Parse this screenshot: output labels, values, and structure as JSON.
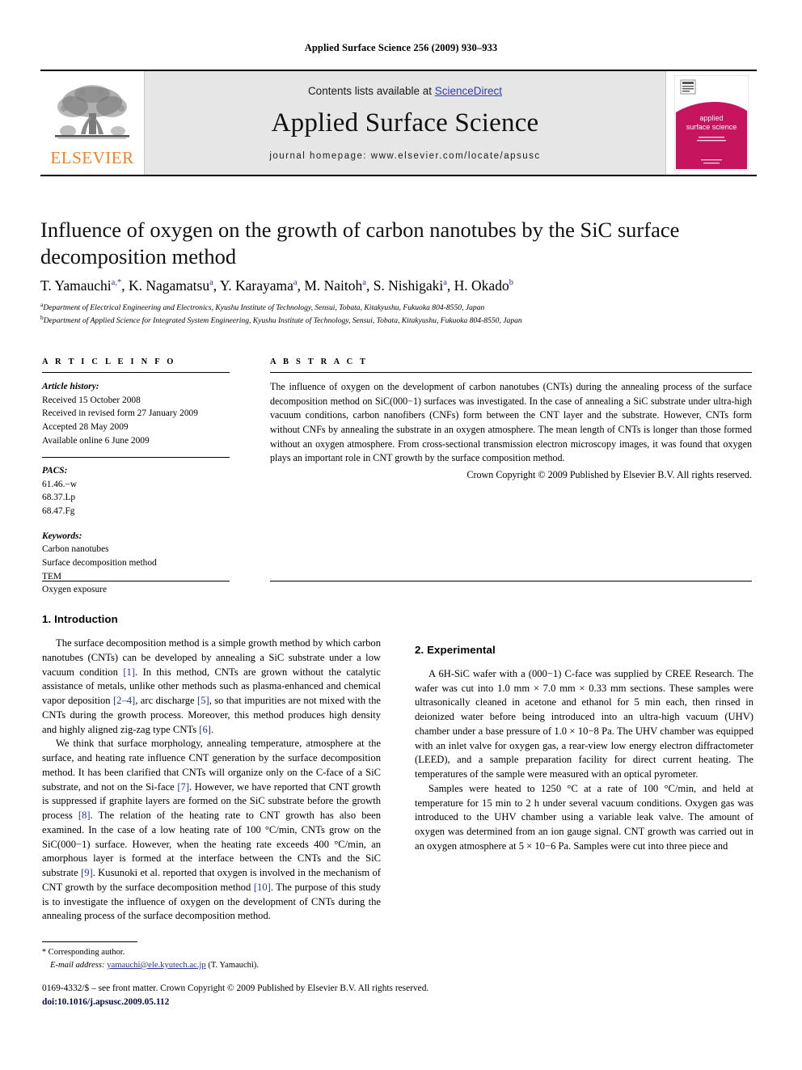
{
  "running_head": "Applied Surface Science 256 (2009) 930–933",
  "masthead": {
    "publisher_name": "ELSEVIER",
    "publisher_logo_icon": "elsevier-tree-icon",
    "contents_prefix": "Contents lists available at ",
    "contents_link": "ScienceDirect",
    "journal_title": "Applied Surface Science",
    "homepage": "journal homepage: www.elsevier.com/locate/apsusc",
    "cover_title_line1": "applied",
    "cover_title_line2": "surface science",
    "cover_color": "#C6145F"
  },
  "article": {
    "title": "Influence of oxygen on the growth of carbon nanotubes by the SiC surface decomposition method",
    "authors": "T. Yamauchi a,*, K. Nagamatsu a, Y. Karayama a, M. Naitoh a, S. Nishigaki a, H. Okado b",
    "affiliation_a": "Department of Electrical Engineering and Electronics, Kyushu Institute of Technology, Sensui, Tobata, Kitakyushu, Fukuoka 804-8550, Japan",
    "affiliation_b": "Department of Applied Science for Integrated System Engineering, Kyushu Institute of Technology, Sensui, Tobata, Kitakyushu, Fukuoka 804-8550, Japan"
  },
  "info": {
    "heading": "A R T I C L E   I N F O",
    "history_label": "Article history:",
    "history": [
      "Received 15 October 2008",
      "Received in revised form 27 January 2009",
      "Accepted 28 May 2009",
      "Available online 6 June 2009"
    ],
    "pacs_label": "PACS:",
    "pacs": [
      "61.46.−w",
      "68.37.Lp",
      "68.47.Fg"
    ],
    "keywords_label": "Keywords:",
    "keywords": [
      "Carbon nanotubes",
      "Surface decomposition method",
      "TEM",
      "Oxygen exposure"
    ]
  },
  "abstract": {
    "heading": "A B S T R A C T",
    "text": "The influence of oxygen on the development of carbon nanotubes (CNTs) during the annealing process of the surface decomposition method on SiC(000−1) surfaces was investigated. In the case of annealing a SiC substrate under ultra-high vacuum conditions, carbon nanofibers (CNFs) form between the CNT layer and the substrate. However, CNTs form without CNFs by annealing the substrate in an oxygen atmosphere. The mean length of CNTs is longer than those formed without an oxygen atmosphere. From cross-sectional transmission electron microscopy images, it was found that oxygen plays an important role in CNT growth by the surface composition method.",
    "copyright": "Crown Copyright © 2009 Published by Elsevier B.V. All rights reserved."
  },
  "body": {
    "section1_heading": "1. Introduction",
    "section1_p1_a": "The surface decomposition method is a simple growth method by which carbon nanotubes (CNTs) can be developed by annealing a SiC substrate under a low vacuum condition ",
    "section1_p1_cite1": "[1]",
    "section1_p1_b": ". In this method, CNTs are grown without the catalytic assistance of metals, unlike other methods such as plasma-enhanced and chemical vapor deposition ",
    "section1_p1_cite2": "[2–4]",
    "section1_p1_c": ", arc discharge ",
    "section1_p1_cite3": "[5]",
    "section1_p1_d": ", so that impurities are not mixed with the CNTs during the growth process. Moreover, this method produces high density and highly aligned zig-zag type CNTs ",
    "section1_p1_cite4": "[6]",
    "section1_p1_e": ".",
    "section1_p2_a": "We think that surface morphology, annealing temperature, atmosphere at the surface, and heating rate influence CNT generation by the surface decomposition method. It has been clarified that CNTs will organize only on the C-face of a SiC substrate, and not on the Si-face ",
    "section1_p2_cite1": "[7]",
    "section1_p2_b": ". However, we have reported that CNT growth is suppressed if graphite layers are formed on the SiC substrate before the growth process ",
    "section1_p2_cite2": "[8]",
    "section1_p2_c": ". The relation of the heating rate to CNT growth has also been examined. In the case of a low heating rate of 100 °C/min, CNTs grow on the SiC(000−1) surface. However, when the heating rate exceeds 400 °C/min, an amorphous layer is formed at the interface between the CNTs and the SiC substrate ",
    "section1_p2_cite3": "[9]",
    "section1_p2_d": ". Kusunoki et al. reported that oxygen is involved in the mechanism of CNT growth by the surface decomposition method ",
    "section1_p2_cite4": "[10]",
    "section1_p2_e": ". The purpose of this study is to investigate the influence of oxygen on the development of CNTs during the annealing process of the surface decomposition method.",
    "section2_heading": "2. Experimental",
    "section2_p1": "A 6H-SiC wafer with a (000−1) C-face was supplied by CREE Research. The wafer was cut into 1.0 mm × 7.0 mm × 0.33 mm sections. These samples were ultrasonically cleaned in acetone and ethanol for 5 min each, then rinsed in deionized water before being introduced into an ultra-high vacuum (UHV) chamber under a base pressure of 1.0 × 10−8 Pa. The UHV chamber was equipped with an inlet valve for oxygen gas, a rear-view low energy electron diffractometer (LEED), and a sample preparation facility for direct current heating. The temperatures of the sample were measured with an optical pyrometer.",
    "section2_p2": "Samples were heated to 1250 °C at a rate of 100 °C/min, and held at temperature for 15 min to 2 h under several vacuum conditions. Oxygen gas was introduced to the UHV chamber using a variable leak valve. The amount of oxygen was determined from an ion gauge signal. CNT growth was carried out in an oxygen atmosphere at 5 × 10−6 Pa. Samples were cut into three piece and"
  },
  "footnote": {
    "star": "*",
    "corresponding": "Corresponding author.",
    "email_label": "E-mail address:",
    "email": "yamauchi@ele.kyutech.ac.jp",
    "email_suffix": "(T. Yamauchi)."
  },
  "footer": {
    "issn_line": "0169-4332/$ – see front matter. Crown Copyright © 2009 Published by Elsevier B.V. All rights reserved.",
    "doi": "doi:10.1016/j.apsusc.2009.05.112"
  }
}
